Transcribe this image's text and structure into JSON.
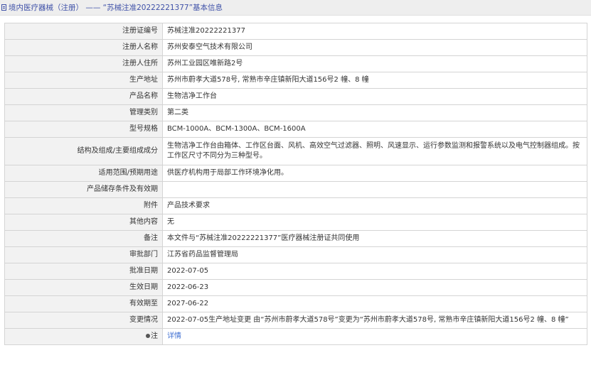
{
  "header": {
    "title": "境内医疗器械（注册） —— “苏械注准20222221377”基本信息",
    "icon": "document-icon"
  },
  "rows": [
    {
      "label": "注册证编号",
      "value": "苏械注准20222221377"
    },
    {
      "label": "注册人名称",
      "value": "苏州安泰空气技术有限公司"
    },
    {
      "label": "注册人住所",
      "value": "苏州工业园区唯新路2号"
    },
    {
      "label": "生产地址",
      "value": "苏州市蔚孝大道578号, 常熟市辛庄镇新阳大道156号2 幢、8 幢"
    },
    {
      "label": "产品名称",
      "value": "生物洁净工作台"
    },
    {
      "label": "管理类别",
      "value": "第二类"
    },
    {
      "label": "型号规格",
      "value": "BCM-1000A、BCM-1300A、BCM-1600A"
    },
    {
      "label": "结构及组成/主要组成成分",
      "value": "生物洁净工作台由箱体、工作区台面、风机、高效空气过滤器、照明、风速显示、运行参数监测和报警系统以及电气控制器组成。按工作区尺寸不同分为三种型号。"
    },
    {
      "label": "适用范围/预期用途",
      "value": "供医疗机构用于局部工作环境净化用。"
    },
    {
      "label": "产品储存条件及有效期",
      "value": ""
    },
    {
      "label": "附件",
      "value": "产品技术要求"
    },
    {
      "label": "其他内容",
      "value": "无"
    },
    {
      "label": "备注",
      "value": "本文件与“苏械注准20222221377”医疗器械注册证共同使用"
    },
    {
      "label": "审批部门",
      "value": "江苏省药品监督管理局"
    },
    {
      "label": "批准日期",
      "value": "2022-07-05"
    },
    {
      "label": "生效日期",
      "value": "2022-06-23"
    },
    {
      "label": "有效期至",
      "value": "2027-06-22"
    },
    {
      "label": "变更情况",
      "value": "2022-07-05生产地址变更 由“苏州市蔚孝大道578号”变更为“苏州市蔚孝大道578号, 常熟市辛庄镇新阳大道156号2 幢、8 幢”"
    }
  ],
  "note_row": {
    "label": "注",
    "icon": "bullet-dot-icon",
    "link": "详情"
  },
  "colors": {
    "title": "#3f51a8",
    "link": "#3f6fd1",
    "label_bg": "#f2f2f2",
    "border": "#d4d4d4"
  }
}
